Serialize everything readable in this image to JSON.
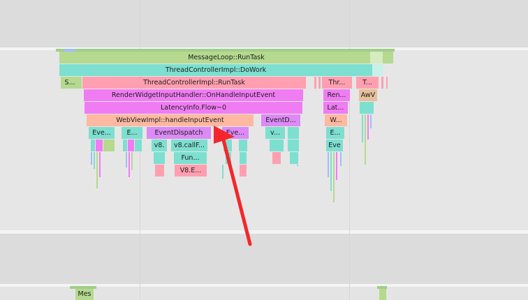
{
  "frames": {
    "message_loop": "MessageLoop::RunTask",
    "thread_controller_dowork": "ThreadControllerImpl::DoWork",
    "s_short": "S...",
    "thread_controller_runtask": "ThreadControllerImpl::RunTask",
    "thr_short": "Thr...",
    "t_short": "T...",
    "render_widget_handler": "RenderWidgetInputHandler::OnHandleInputEvent",
    "ren_short": "Ren...",
    "awv_short": "AwV",
    "latency_flow": "LatencyInfo.Flow~0",
    "lat_short": "Lat...",
    "webview_handle_input": "WebViewImpl::handleInputEvent",
    "eventd_short": "EventD...",
    "w_short": "W...",
    "eve_short_1": "Eve...",
    "e_short_1": "E...",
    "event_dispatch": "EventDispatch",
    "eve_partial": "Eve...",
    "v_short": "v...",
    "e_short_2": "E...",
    "v8_short": "v8.",
    "v8_callf": "v8.callF...",
    "eve_label": "Eve",
    "fun_short": "Fun...",
    "v8_e_short": "V8.E...",
    "mes_short": "Mes"
  },
  "colors": {
    "background": "#e6e6e6",
    "track_band": "#dcdcdc",
    "separator": "#f4f4f4",
    "green_light": "#b5d98f",
    "teal": "#7ddfcf",
    "pink": "#ff9fb0",
    "magenta": "#f07cf4",
    "salmon": "#ffb8a2",
    "violet": "#dc8af5",
    "tan": "#e6c09a",
    "blue_light": "#9fbff5",
    "arrow_red": "#f5262b"
  },
  "annotation": {
    "type": "arrow",
    "points_to": "WebViewImpl::handleInputEvent"
  }
}
